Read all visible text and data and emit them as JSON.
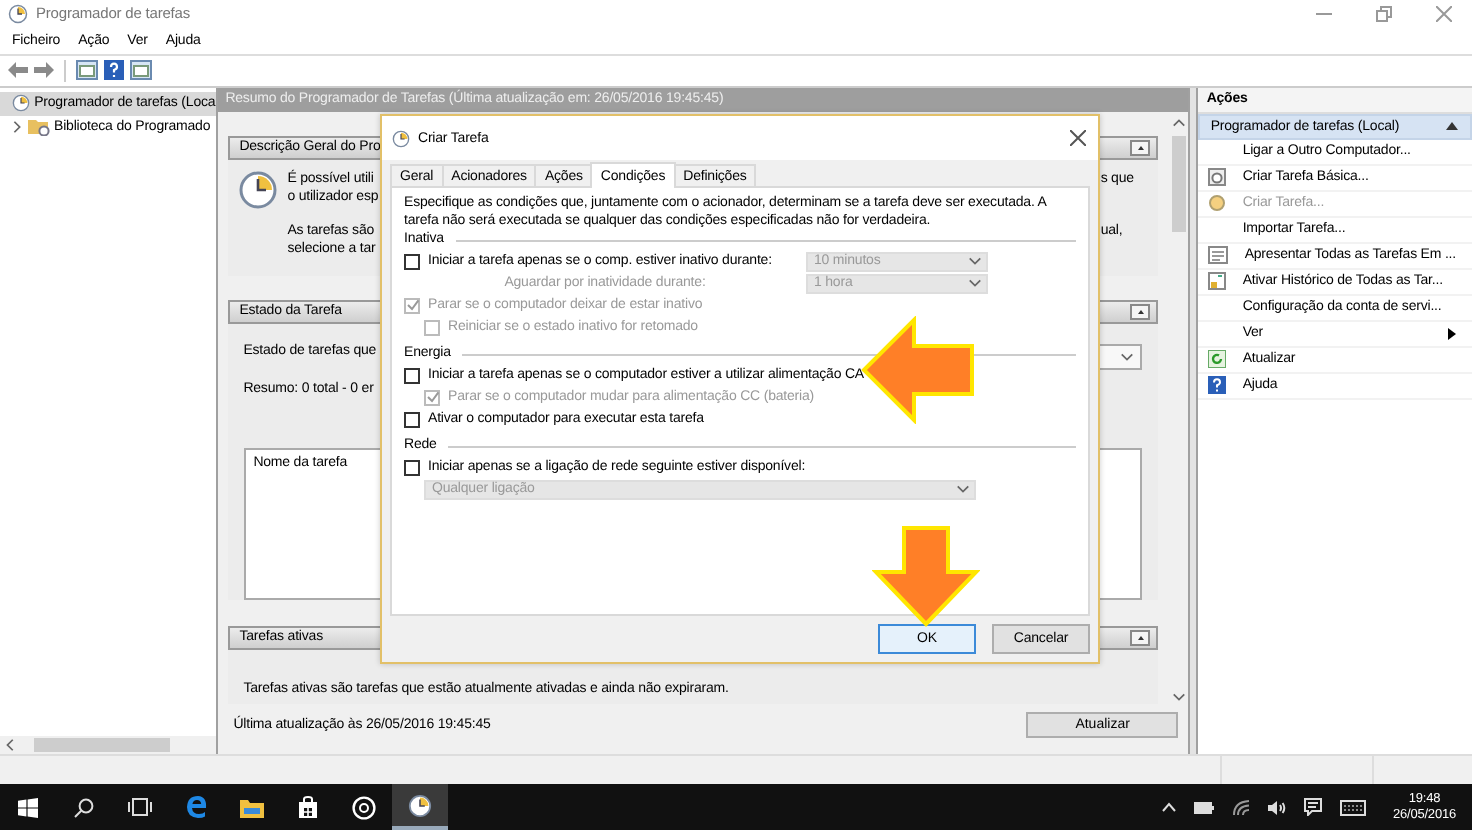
{
  "window": {
    "title": "Programador de tarefas"
  },
  "menu": [
    {
      "label": "Ficheiro"
    },
    {
      "label": "Ação"
    },
    {
      "label": "Ver"
    },
    {
      "label": "Ajuda"
    }
  ],
  "tree": [
    {
      "label": "Programador de tarefas (Loca",
      "selected": true,
      "children": [
        {
          "label": "Biblioteca do Programado",
          "selected": false,
          "expanded": false
        }
      ]
    }
  ],
  "summary": {
    "header": "Resumo do Programador de Tarefas (Última atualização em: 26/05/2016 19:45:45)",
    "overview": {
      "title": "Descrição Geral do Pro",
      "paragraphs": [
        {
          "left": [
            "É possível utili",
            "o utilizador esp"
          ],
          "right": "s que"
        },
        {
          "left": [
            "As tarefas são",
            "selecione a tar"
          ],
          "right": "ual,"
        }
      ]
    },
    "status": {
      "title": "Estado da Tarefa",
      "filter_label": "Estado de tarefas que",
      "total": "Resumo: 0 total - 0 er",
      "columns": [
        "Nome da tarefa"
      ]
    },
    "active": {
      "title": "Tarefas ativas",
      "text": "Tarefas ativas são tarefas que estão atualmente ativadas e ainda não expiraram."
    },
    "last_update": "Última atualização às 26/05/2016 19:45:45",
    "refresh_button": "Atualizar"
  },
  "actions": {
    "title": "Ações",
    "group": {
      "label": "Programador de tarefas (Local)",
      "expanded": true
    },
    "items": [
      {
        "label": "Ligar a Outro Computador...",
        "kind": "plain",
        "disabled": false
      },
      {
        "label": "Criar Tarefa Básica...",
        "kind": "wizard",
        "disabled": false
      },
      {
        "label": "Criar Tarefa...",
        "kind": "task",
        "disabled": true
      },
      {
        "label": "Importar Tarefa...",
        "kind": "plain",
        "disabled": false
      },
      {
        "label": "Apresentar Todas as Tarefas Em ...",
        "kind": "list",
        "disabled": false
      },
      {
        "label": "Ativar Histórico de Todas as Tar...",
        "kind": "history",
        "disabled": false
      },
      {
        "label": "Configuração da conta de servi...",
        "kind": "plain",
        "disabled": false
      },
      {
        "label": "Ver",
        "kind": "submenu",
        "disabled": false
      },
      {
        "label": "Atualizar",
        "kind": "refresh",
        "disabled": false
      },
      {
        "label": "Ajuda",
        "kind": "help",
        "disabled": false
      }
    ]
  },
  "dialog": {
    "title": "Criar Tarefa",
    "tabs": [
      {
        "label": "Geral",
        "selected": false
      },
      {
        "label": "Acionadores",
        "selected": false
      },
      {
        "label": "Ações",
        "selected": false
      },
      {
        "label": "Condições",
        "selected": true
      },
      {
        "label": "Definições",
        "selected": false
      }
    ],
    "intro": "Especifique as condições que, juntamente com o acionador, determinam se a tarefa deve ser executada. A tarefa não será executada se qualquer das condições especificadas não for verdadeira.",
    "groups": [
      {
        "title": "Inativa",
        "rows": [
          {
            "kind": "checkbox",
            "label": "Iniciar a tarefa apenas se o comp. estiver inativo durante:",
            "checked": false,
            "disabled": false,
            "select": {
              "value": "10 minutos",
              "disabled": true
            }
          },
          {
            "kind": "label",
            "label": "Aguardar por inatividade durante:",
            "disabled": true,
            "select": {
              "value": "1 hora",
              "disabled": true
            }
          },
          {
            "kind": "checkbox",
            "label": "Parar se o computador deixar de estar inativo",
            "checked": true,
            "disabled": true,
            "children": [
              {
                "kind": "checkbox",
                "label": "Reiniciar se o estado inativo for retomado",
                "checked": false,
                "disabled": true
              }
            ]
          }
        ]
      },
      {
        "title": "Energia",
        "rows": [
          {
            "kind": "checkbox",
            "label": "Iniciar a tarefa apenas se o computador estiver a utilizar alimentação CA",
            "checked": false,
            "disabled": false,
            "children": [
              {
                "kind": "checkbox",
                "label": "Parar se o computador mudar para alimentação CC (bateria)",
                "checked": true,
                "disabled": true
              }
            ]
          },
          {
            "kind": "checkbox",
            "label": "Ativar o computador para executar esta tarefa",
            "checked": false,
            "disabled": false
          }
        ]
      },
      {
        "title": "Rede",
        "rows": [
          {
            "kind": "checkbox",
            "label": "Iniciar apenas se a ligação de rede seguinte estiver disponível:",
            "checked": false,
            "disabled": false,
            "children": [
              {
                "kind": "select",
                "value": "Qualquer ligação",
                "disabled": true
              }
            ]
          }
        ]
      }
    ],
    "buttons": [
      {
        "label": "OK",
        "default": true
      },
      {
        "label": "Cancelar",
        "default": false
      }
    ]
  },
  "taskbar": {
    "time": "19:48",
    "date": "26/05/2016"
  }
}
